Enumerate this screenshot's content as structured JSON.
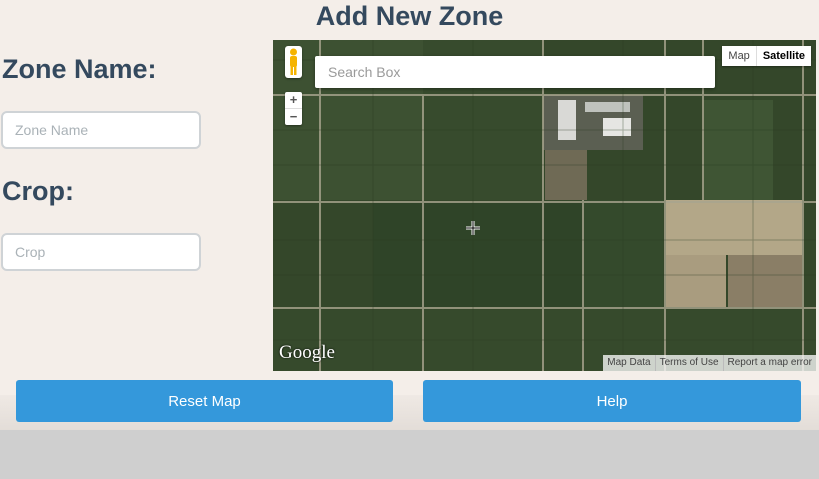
{
  "page": {
    "title": "Add New Zone"
  },
  "form": {
    "zone_name_label": "Zone Name:",
    "zone_name_placeholder": "Zone Name",
    "zone_name_value": "",
    "crop_label": "Crop:",
    "crop_placeholder": "Crop",
    "crop_value": ""
  },
  "map": {
    "search_placeholder": "Search Box",
    "zoom_in": "+",
    "zoom_out": "−",
    "type_map": "Map",
    "type_satellite": "Satellite",
    "active_type": "Satellite",
    "logo": "Google",
    "attribution": {
      "map_data": "Map Data",
      "terms": "Terms of Use",
      "report": "Report a map error"
    }
  },
  "buttons": {
    "reset": "Reset Map",
    "help": "Help"
  },
  "colors": {
    "title": "#34495e",
    "button": "#3498db",
    "background": "#f4eee9"
  }
}
